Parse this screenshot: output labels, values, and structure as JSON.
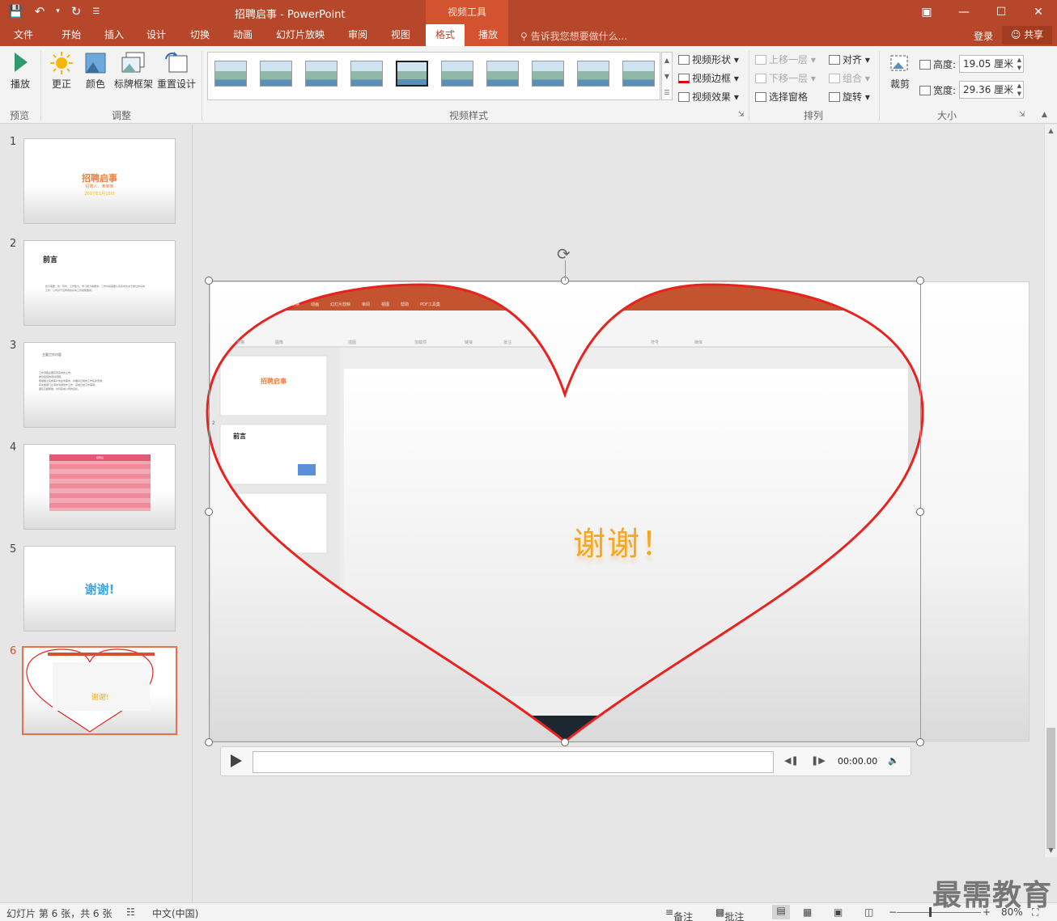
{
  "app": {
    "title": "招聘启事 - PowerPoint",
    "context_tab_header": "视频工具"
  },
  "tabs": [
    "文件",
    "开始",
    "插入",
    "设计",
    "切换",
    "动画",
    "幻灯片放映",
    "审阅",
    "视图",
    "格式",
    "播放"
  ],
  "active_tab": "格式",
  "tell_me": "告诉我您想要做什么...",
  "account": {
    "login": "登录",
    "share": "共享"
  },
  "ribbon": {
    "preview": {
      "play": "播放",
      "group": "预览"
    },
    "adjust": {
      "correct": "更正",
      "color": "颜色",
      "poster_frame": "标牌框架",
      "reset_design": "重置设计",
      "group": "调整"
    },
    "styles": {
      "group": "视频样式",
      "shape": "视频形状",
      "border": "视频边框",
      "effects": "视频效果"
    },
    "arrange": {
      "group": "排列",
      "bring_forward": "上移一层",
      "send_backward": "下移一层",
      "selection_pane": "选择窗格",
      "align": "对齐",
      "group_cmd": "组合",
      "rotate": "旋转"
    },
    "size": {
      "group": "大小",
      "crop": "裁剪",
      "height_label": "高度:",
      "height_value": "19.05 厘米",
      "width_label": "宽度:",
      "width_value": "29.36 厘米"
    }
  },
  "slides": [
    {
      "num": "1",
      "title": "招聘启事",
      "subtitle": "招聘人：某某某",
      "date": "2017年1月15日"
    },
    {
      "num": "2",
      "title": "前言",
      "body": "我们需要：热，同时，工作能力，学习能力等要求。工作时候需要认真完成的关于岗位的基本工作。公司对于应聘者的基本工作技能要求。"
    },
    {
      "num": "3",
      "title": "主要工作内容",
      "lines": [
        "工作流程主要实现完成的工作；",
        "岗位接受的培训流程；",
        "能够独立完成客户的业务需求，并做好日常的工作任务安排；",
        "有关各部门之间的沟通协作工作，完成日常工作事项；",
        "团队互相帮助，共同完成公司的目标。"
      ]
    },
    {
      "num": "4",
      "table_header": "招聘表"
    },
    {
      "num": "5",
      "text": "谢谢!"
    },
    {
      "num": "6",
      "text": "谢谢!"
    }
  ],
  "active_slide": "6",
  "main_slide": {
    "inner_tabs": [
      "切换",
      "动画",
      "幻灯片放映",
      "审阅",
      "视图",
      "帮助",
      "PDF工具集"
    ],
    "inner_groups": [
      "表格",
      "图像",
      "插图",
      "加载项",
      "链接",
      "批注",
      "符号",
      "媒体"
    ],
    "inner_thumb_title_1": "招聘启事",
    "inner_thumb_title_2": "前言",
    "inner_slide_num": "2",
    "center_text": "谢谢！"
  },
  "player": {
    "time": "00:00.00"
  },
  "status": {
    "slide_info": "幻灯片 第 6 张，共 6 张",
    "language": "中文(中国)",
    "notes": "备注",
    "comments": "批注",
    "zoom": "80%"
  },
  "watermark": "最需教育",
  "colors": {
    "brand": "#b7472a",
    "context": "#d35230",
    "heart_outline": "#e8231f",
    "thank_you": "#f5a623",
    "thumb5_text": "#3ba7e8"
  }
}
